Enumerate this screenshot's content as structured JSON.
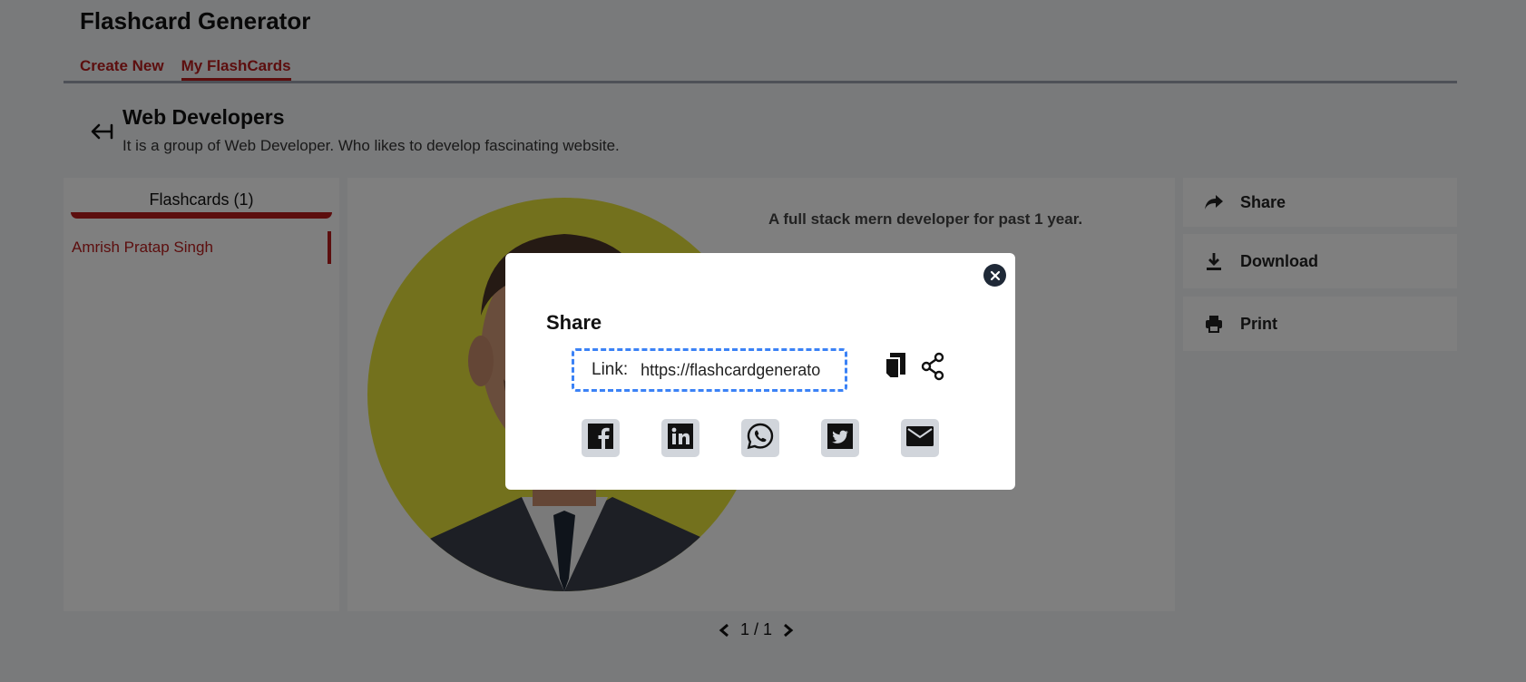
{
  "header": {
    "app_title": "Flashcard Generator",
    "nav": [
      {
        "label": "Create New",
        "active": false
      },
      {
        "label": "My FlashCards",
        "active": true
      }
    ]
  },
  "group": {
    "title": "Web Developers",
    "description": "It is a group of Web Developer. Who likes to develop fascinating website."
  },
  "sidebar": {
    "heading": "Flashcards (1)",
    "items": [
      {
        "label": "Amrish Pratap Singh",
        "active": true
      }
    ]
  },
  "card": {
    "text": "A full stack mern developer for past 1 year.",
    "image_bg": "#e6e23a"
  },
  "actions": [
    {
      "label": "Share",
      "icon": "share-arrow-icon"
    },
    {
      "label": "Download",
      "icon": "download-icon"
    },
    {
      "label": "Print",
      "icon": "printer-icon"
    }
  ],
  "pagination": {
    "text": "1 / 1"
  },
  "modal": {
    "title": "Share",
    "link_label": "Link:",
    "link_value": "https://flashcardgenerato",
    "social": [
      {
        "name": "facebook-icon"
      },
      {
        "name": "linkedin-icon"
      },
      {
        "name": "whatsapp-icon"
      },
      {
        "name": "twitter-icon"
      },
      {
        "name": "email-icon"
      }
    ]
  },
  "colors": {
    "accent": "#b91c1c",
    "link_border": "#3b82f6",
    "overlay": "rgba(0,0,0,0.5)"
  }
}
